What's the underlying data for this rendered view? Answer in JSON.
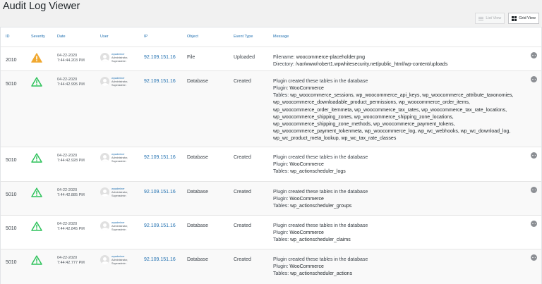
{
  "page": {
    "title": "Audit Log Viewer"
  },
  "view_switch": {
    "list_label": "List View",
    "grid_label": "Grid View"
  },
  "columns": {
    "id": "ID",
    "severity": "Severity",
    "date": "Date",
    "user": "User",
    "ip": "IP",
    "object": "Object",
    "event_type": "Event Type",
    "message": "Message"
  },
  "severity_colors": {
    "warning": "#f0a830",
    "notice": "#2ec25b"
  },
  "rows": [
    {
      "id": "2010",
      "severity": "warning",
      "severity_icon": "warning-triangle-filled-icon",
      "date": "04-22-2020",
      "time": "7:44:44.203 PM",
      "user": {
        "name": "wpadminer",
        "role1": "Administrator,",
        "role2": "Superadmin"
      },
      "ip": "92.109.151.16",
      "object": "File",
      "event_type": "Uploaded",
      "message": [
        {
          "label": "Filename: ",
          "value": "woocommerce-placeholder.png"
        },
        {
          "label": "Directory: ",
          "value": "/var/www/robert1.wpwhitesecurity.net/public_html/wp-content/uploads"
        }
      ]
    },
    {
      "id": "5010",
      "severity": "notice",
      "severity_icon": "notice-triangle-outline-icon",
      "date": "04-22-2020",
      "time": "7:44:42.995 PM",
      "user": {
        "name": "wpadminer",
        "role1": "Administrator,",
        "role2": "Superadmin"
      },
      "ip": "92.109.151.16",
      "object": "Database",
      "event_type": "Created",
      "message": [
        {
          "label": "Plugin created these tables in the database",
          "value": ""
        },
        {
          "label": "Plugin: ",
          "value": "WooCommerce"
        },
        {
          "label": "Tables: ",
          "value": "wp_woocommerce_sessions, wp_woocommerce_api_keys, wp_woocommerce_attribute_taxonomies,"
        },
        {
          "label": "",
          "value": "wp_woocommerce_downloadable_product_permissions, wp_woocommerce_order_items,"
        },
        {
          "label": "",
          "value": "wp_woocommerce_order_itemmeta, wp_woocommerce_tax_rates, wp_woocommerce_tax_rate_locations,"
        },
        {
          "label": "",
          "value": "wp_woocommerce_shipping_zones, wp_woocommerce_shipping_zone_locations,"
        },
        {
          "label": "",
          "value": "wp_woocommerce_shipping_zone_methods, wp_woocommerce_payment_tokens,"
        },
        {
          "label": "",
          "value": "wp_woocommerce_payment_tokenmeta, wp_woocommerce_log, wp_wc_webhooks, wp_wc_download_log,"
        },
        {
          "label": "",
          "value": "wp_wc_product_meta_lookup, wp_wc_tax_rate_classes"
        }
      ]
    },
    {
      "id": "5010",
      "severity": "notice",
      "severity_icon": "notice-triangle-outline-icon",
      "date": "04-22-2020",
      "time": "7:44:42.928 PM",
      "user": {
        "name": "wpadminer",
        "role1": "Administrator,",
        "role2": "Superadmin"
      },
      "ip": "92.109.151.16",
      "object": "Database",
      "event_type": "Created",
      "message": [
        {
          "label": "Plugin created these tables in the database",
          "value": ""
        },
        {
          "label": "Plugin: ",
          "value": "WooCommerce"
        },
        {
          "label": "Tables: ",
          "value": "wp_actionscheduler_logs"
        }
      ]
    },
    {
      "id": "5010",
      "severity": "notice",
      "severity_icon": "notice-triangle-outline-icon",
      "date": "04-22-2020",
      "time": "7:44:42.885 PM",
      "user": {
        "name": "wpadminer",
        "role1": "Administrator,",
        "role2": "Superadmin"
      },
      "ip": "92.109.151.16",
      "object": "Database",
      "event_type": "Created",
      "message": [
        {
          "label": "Plugin created these tables in the database",
          "value": ""
        },
        {
          "label": "Plugin: ",
          "value": "WooCommerce"
        },
        {
          "label": "Tables: ",
          "value": "wp_actionscheduler_groups"
        }
      ]
    },
    {
      "id": "5010",
      "severity": "notice",
      "severity_icon": "notice-triangle-outline-icon",
      "date": "04-22-2020",
      "time": "7:44:42.845 PM",
      "user": {
        "name": "wpadminer",
        "role1": "Administrator,",
        "role2": "Superadmin"
      },
      "ip": "92.109.151.16",
      "object": "Database",
      "event_type": "Created",
      "message": [
        {
          "label": "Plugin created these tables in the database",
          "value": ""
        },
        {
          "label": "Plugin: ",
          "value": "WooCommerce"
        },
        {
          "label": "Tables: ",
          "value": "wp_actionscheduler_claims"
        }
      ]
    },
    {
      "id": "5010",
      "severity": "notice",
      "severity_icon": "notice-triangle-outline-icon",
      "date": "04-22-2020",
      "time": "7:44:42.777 PM",
      "user": {
        "name": "wpadminer",
        "role1": "Administrator,",
        "role2": "Superadmin"
      },
      "ip": "92.109.151.16",
      "object": "Database",
      "event_type": "Created",
      "message": [
        {
          "label": "Plugin created these tables in the database",
          "value": ""
        },
        {
          "label": "Plugin: ",
          "value": "WooCommerce"
        },
        {
          "label": "Tables: ",
          "value": "wp_actionscheduler_actions"
        }
      ]
    }
  ]
}
